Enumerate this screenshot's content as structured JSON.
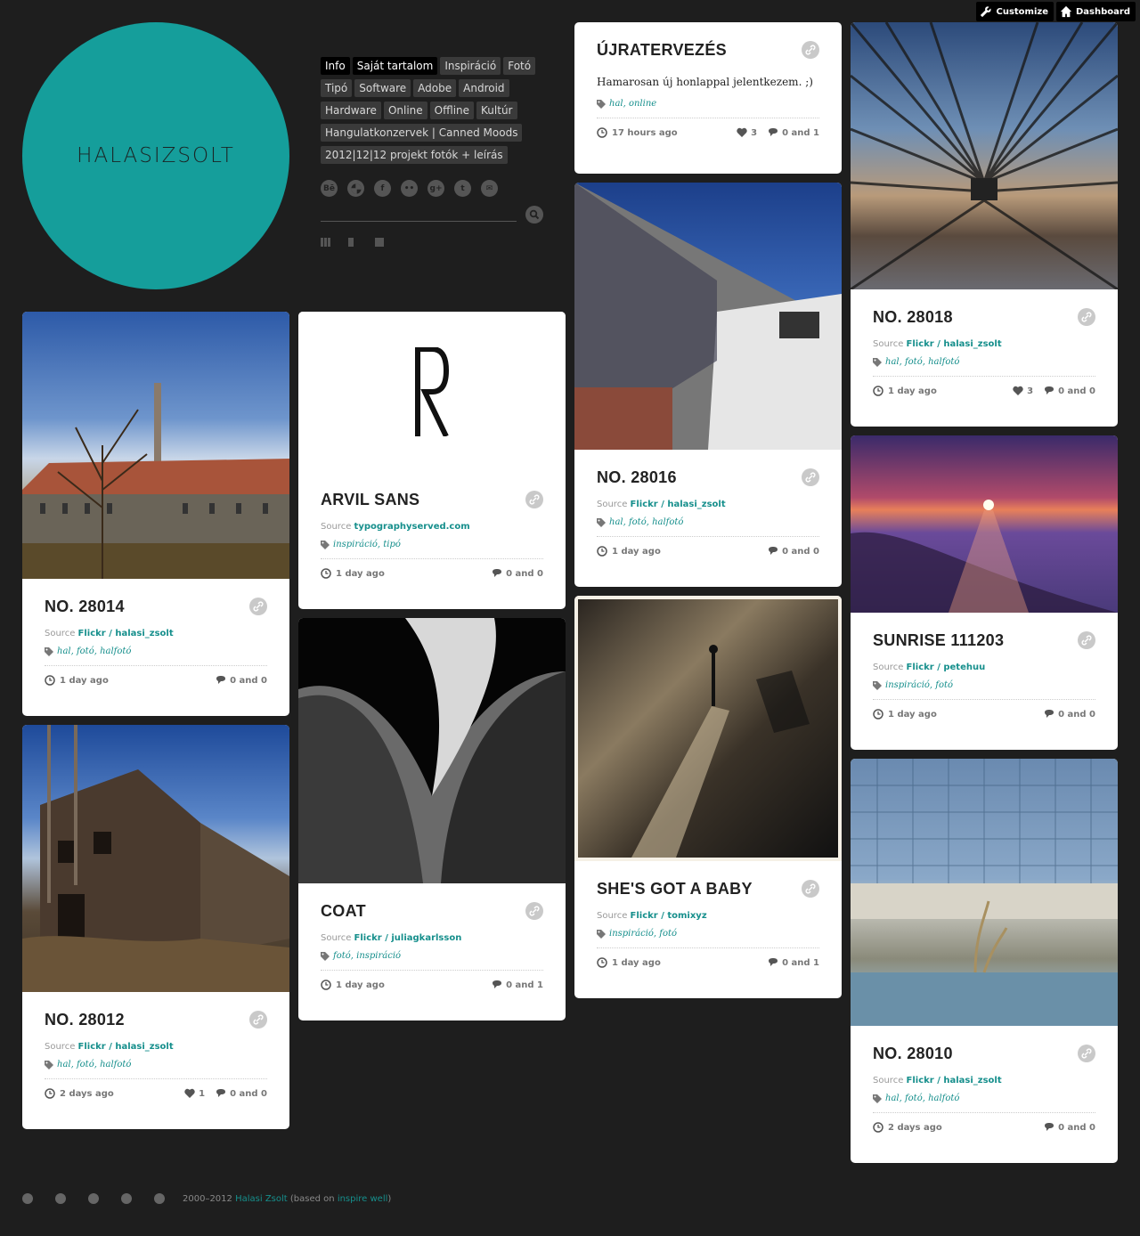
{
  "topbar": {
    "customize": "Customize",
    "dashboard": "Dashboard"
  },
  "logo": {
    "text": "HALASIZSOLT",
    "color": "#159e9b"
  },
  "nav": {
    "rows": [
      [
        "Info",
        "Saját tartalom",
        "Inspiráció",
        "Fotó"
      ],
      [
        "Tipó",
        "Software",
        "Adobe",
        "Android"
      ],
      [
        "Hardware",
        "Online",
        "Offline",
        "Kultúr"
      ],
      [
        "Hangulatkonzervek | Canned Moods"
      ],
      [
        "2012|12|12 projekt fotók + leírás"
      ]
    ],
    "active": [
      "Info",
      "Saját tartalom"
    ]
  },
  "social": [
    "behance-icon",
    "dribbble-icon",
    "facebook-icon",
    "flickr-icon",
    "googleplus-icon",
    "twitter-icon",
    "email-icon"
  ],
  "social_glyphs": [
    "Bē",
    "",
    "f",
    "••",
    "g+",
    "t",
    "✉"
  ],
  "posts": {
    "p1": {
      "title": "ÚJRATERVEZÉS",
      "text": "Hamarosan új honlappal jelentkezem. ;)",
      "tags": "hal, online",
      "ago": "17 hours ago",
      "likes": "3",
      "comments": "0 and 1"
    },
    "p2": {
      "title": "NO. 28018",
      "source_label": "Source",
      "source": "Flickr / halasi_zsolt",
      "tags": "hal, fotó, halfotó",
      "ago": "1 day ago",
      "likes": "3",
      "comments": "0 and 0"
    },
    "p3": {
      "title": "NO. 28016",
      "source_label": "Source",
      "source": "Flickr / halasi_zsolt",
      "tags": "hal, fotó, halfotó",
      "ago": "1 day ago",
      "comments": "0 and 0"
    },
    "p4": {
      "title": "ARVIL SANS",
      "glyph": "R",
      "source_label": "Source",
      "source": "typographyserved.com",
      "tags": "inspiráció, tipó",
      "ago": "1 day ago",
      "comments": "0 and 0"
    },
    "p5": {
      "title": "NO. 28014",
      "source_label": "Source",
      "source": "Flickr / halasi_zsolt",
      "tags": "hal, fotó, halfotó",
      "ago": "1 day ago",
      "comments": "0 and 0"
    },
    "p6": {
      "title": "SUNRISE 111203",
      "source_label": "Source",
      "source": "Flickr / petehuu",
      "tags": "inspiráció, fotó",
      "ago": "1 day ago",
      "comments": "0 and 0"
    },
    "p7": {
      "title": "SHE'S GOT A BABY",
      "source_label": "Source",
      "source": "Flickr / tomixyz",
      "tags": "inspiráció, fotó",
      "ago": "1 day ago",
      "comments": "0 and 1"
    },
    "p8": {
      "title": "COAT",
      "source_label": "Source",
      "source": "Flickr / juliagkarlsson",
      "tags": "fotó, inspiráció",
      "ago": "1 day ago",
      "comments": "0 and 1"
    },
    "p9": {
      "title": "NO. 28012",
      "source_label": "Source",
      "source": "Flickr / halasi_zsolt",
      "tags": "hal, fotó, halfotó",
      "ago": "2 days ago",
      "likes": "1",
      "comments": "0 and 0"
    },
    "p10": {
      "title": "NO. 28010",
      "source_label": "Source",
      "source": "Flickr / halasi_zsolt",
      "tags": "hal, fotó, halfotó",
      "ago": "2 days ago",
      "comments": "0 and 0"
    }
  },
  "footer": {
    "years": "2000–2012",
    "author": "Halasi Zsolt",
    "based_pre": "(based on",
    "theme": "inspire well",
    "based_post": ")"
  },
  "accent": "#168f8c"
}
